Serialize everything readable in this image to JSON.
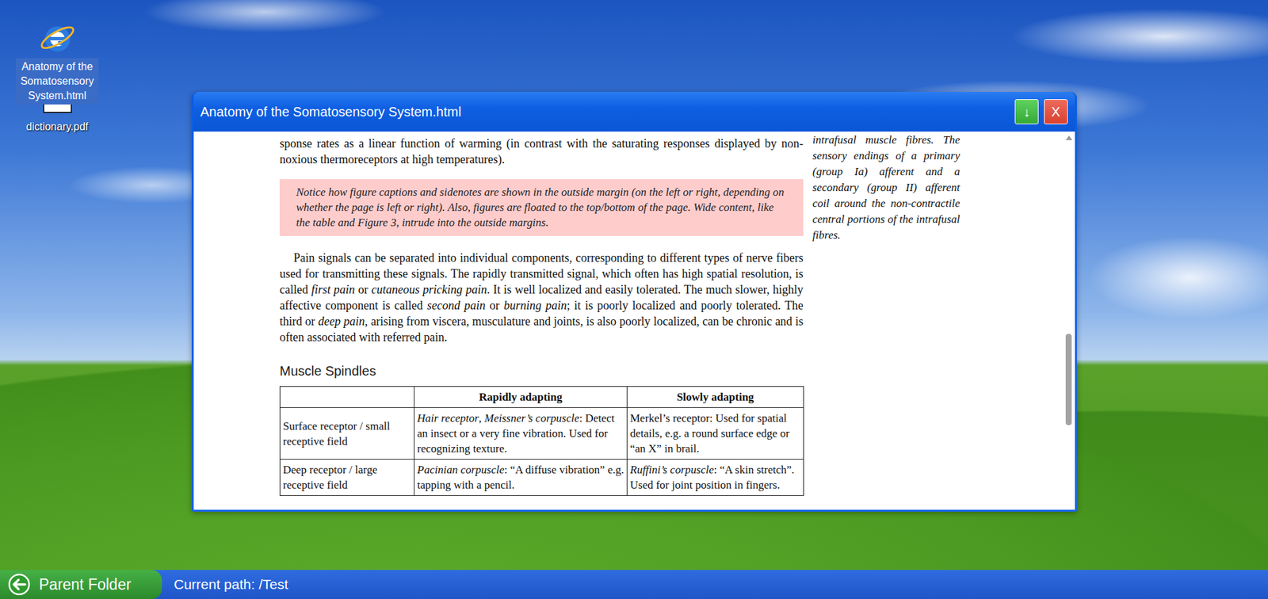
{
  "desktop": {
    "icons": [
      {
        "label": "Anatomy of the Somatosensory System.html",
        "kind": "html",
        "selected": true
      },
      {
        "label": "dictionary.pdf",
        "kind": "pdf",
        "selected": false
      }
    ]
  },
  "window": {
    "title": "Anatomy of the Somatosensory System.html",
    "buttons": [
      {
        "label": "↓",
        "kind": "minimize"
      },
      {
        "label": "X",
        "kind": "close"
      }
    ]
  },
  "document": {
    "blocks": [
      {
        "kind": "paragraph",
        "indent": false,
        "segments": [
          {
            "text": "sponse rates as a linear function of warming (in contrast with the saturating responses displayed by non-noxious thermoreceptors at high temperatures).",
            "italic": false
          }
        ]
      },
      {
        "kind": "note",
        "segments": [
          {
            "text": "Notice how figure captions and sidenotes are shown in the outside margin (on the left or right, depending on whether the page is left or right). Also, figures are floated to the top/bottom of the page. Wide content, like the table and Figure 3, intrude into the outside margins.",
            "italic": true
          }
        ]
      },
      {
        "kind": "paragraph",
        "indent": true,
        "segments": [
          {
            "text": "Pain signals can be separated into individual components, corresponding to different types of nerve fibers used for transmitting these signals. The rapidly transmitted signal, which often has high spatial resolution, is called ",
            "italic": false
          },
          {
            "text": "first pain",
            "italic": true
          },
          {
            "text": " or ",
            "italic": false
          },
          {
            "text": "cutaneous pricking pain",
            "italic": true
          },
          {
            "text": ". It is well localized and easily tolerated. The much slower, highly affective component is called ",
            "italic": false
          },
          {
            "text": "second pain",
            "italic": true
          },
          {
            "text": " or ",
            "italic": false
          },
          {
            "text": "burning pain",
            "italic": true
          },
          {
            "text": "; it is poorly localized and poorly tolerated. The third or ",
            "italic": false
          },
          {
            "text": "deep pain",
            "italic": true
          },
          {
            "text": ", arising from viscera, musculature and joints, is also poorly localized, can be chronic and is often associated with referred pain.",
            "italic": false
          }
        ]
      },
      {
        "kind": "heading",
        "text": "Muscle Spindles"
      },
      {
        "kind": "table",
        "columns": [
          "",
          "Rapidly adapting",
          "Slowly adapting"
        ],
        "rows": [
          {
            "label": "Surface receptor / small receptive field",
            "cells": [
              [
                {
                  "text": "Hair receptor",
                  "italic": true
                },
                {
                  "text": ", ",
                  "italic": false
                },
                {
                  "text": "Meissner’s corpuscle",
                  "italic": true
                },
                {
                  "text": ": Detect an insect or a very fine vibration. Used for recognizing texture.",
                  "italic": false
                }
              ],
              [
                {
                  "text": "Merkel’s receptor: Used for spatial details, e.g. a round surface edge or “an X” in brail.",
                  "italic": false
                }
              ]
            ]
          },
          {
            "label": "Deep receptor / large receptive field",
            "cells": [
              [
                {
                  "text": "Pacinian corpuscle",
                  "italic": true
                },
                {
                  "text": ": “A diffuse vibration” e.g. tapping with a pencil.",
                  "italic": false
                }
              ],
              [
                {
                  "text": "Ruffini’s corpuscle",
                  "italic": true
                },
                {
                  "text": ": “A skin stretch”. Used for joint position in fingers.",
                  "italic": false
                }
              ]
            ]
          }
        ]
      }
    ],
    "sidenote": "intrafusal muscle fibres. The sensory endings of a primary (group Ia) afferent and a secondary (group II) afferent coil around the non-contractile central portions of the intrafusal fibres.",
    "scrollbar": {
      "offset": 0.52,
      "size": 0.25
    }
  },
  "taskbar": {
    "button": "Parent Folder",
    "path": "Current path: /Test"
  }
}
